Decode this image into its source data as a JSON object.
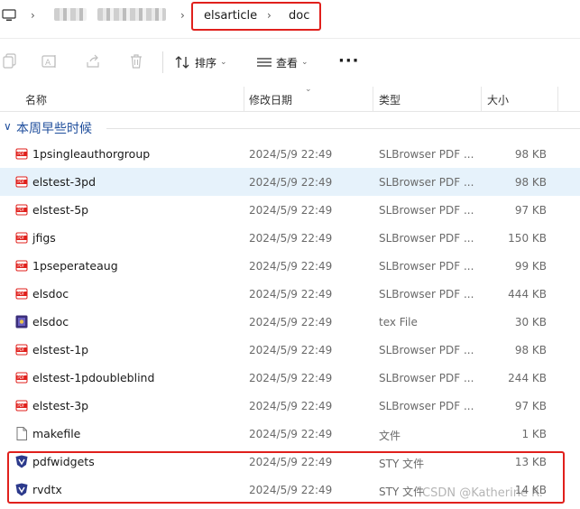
{
  "breadcrumb": {
    "items": [
      "elsarticle",
      "doc"
    ]
  },
  "toolbar": {
    "sort_label": "排序",
    "view_label": "查看",
    "more_label": "···"
  },
  "columns": {
    "name": "名称",
    "date": "修改日期",
    "type": "类型",
    "size": "大小"
  },
  "group": {
    "title": "本周早些时候"
  },
  "files": [
    {
      "name": "1psingleauthorgroup",
      "date": "2024/5/9 22:49",
      "type": "SLBrowser PDF ...",
      "size": "98 KB",
      "icon": "pdf-icon"
    },
    {
      "name": "elstest-3pd",
      "date": "2024/5/9 22:49",
      "type": "SLBrowser PDF ...",
      "size": "98 KB",
      "icon": "pdf-icon"
    },
    {
      "name": "elstest-5p",
      "date": "2024/5/9 22:49",
      "type": "SLBrowser PDF ...",
      "size": "97 KB",
      "icon": "pdf-icon"
    },
    {
      "name": "jfigs",
      "date": "2024/5/9 22:49",
      "type": "SLBrowser PDF ...",
      "size": "150 KB",
      "icon": "pdf-icon"
    },
    {
      "name": "1pseperateaug",
      "date": "2024/5/9 22:49",
      "type": "SLBrowser PDF ...",
      "size": "99 KB",
      "icon": "pdf-icon"
    },
    {
      "name": "elsdoc",
      "date": "2024/5/9 22:49",
      "type": "SLBrowser PDF ...",
      "size": "444 KB",
      "icon": "pdf-icon"
    },
    {
      "name": "elsdoc",
      "date": "2024/5/9 22:49",
      "type": "tex File",
      "size": "30 KB",
      "icon": "tex-icon"
    },
    {
      "name": "elstest-1p",
      "date": "2024/5/9 22:49",
      "type": "SLBrowser PDF ...",
      "size": "98 KB",
      "icon": "pdf-icon"
    },
    {
      "name": "elstest-1pdoubleblind",
      "date": "2024/5/9 22:49",
      "type": "SLBrowser PDF ...",
      "size": "244 KB",
      "icon": "pdf-icon"
    },
    {
      "name": "elstest-3p",
      "date": "2024/5/9 22:49",
      "type": "SLBrowser PDF ...",
      "size": "97 KB",
      "icon": "pdf-icon"
    },
    {
      "name": "makefile",
      "date": "2024/5/9 22:49",
      "type": "文件",
      "size": "1 KB",
      "icon": "file-icon"
    },
    {
      "name": "pdfwidgets",
      "date": "2024/5/9 22:49",
      "type": "STY 文件",
      "size": "13 KB",
      "icon": "sty-icon"
    },
    {
      "name": "rvdtx",
      "date": "2024/5/9 22:49",
      "type": "STY 文件",
      "size": "14 KB",
      "icon": "sty-icon"
    }
  ],
  "selected_index": 1,
  "watermark": "CSDN @Katherine R.",
  "colors": {
    "highlight_border": "#e0201c",
    "selected_row": "#e6f2fb",
    "group_title": "#1f4e9c",
    "pdf_icon": "#e0201c"
  }
}
